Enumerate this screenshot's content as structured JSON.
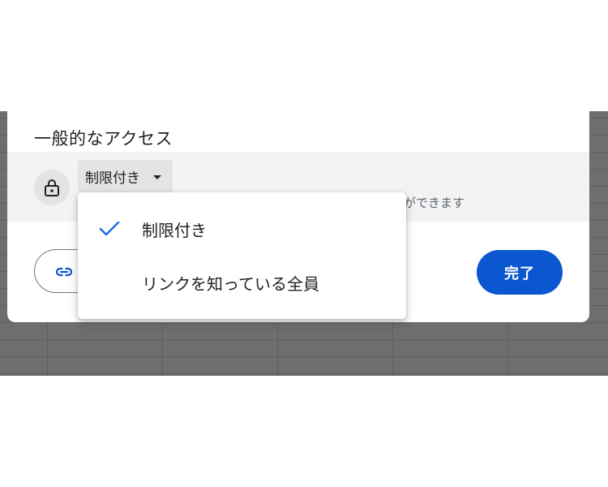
{
  "dialog": {
    "section_title": "一般的なアクセス",
    "access_select": {
      "selected_label": "制限付き",
      "icon": "lock-icon",
      "caret_icon": "caret-down-icon"
    },
    "access_description_visible": "とができます",
    "copy_link_button": {
      "icon": "link-icon"
    },
    "done_label": "完了"
  },
  "access_menu": {
    "items": [
      {
        "label": "制限付き",
        "selected": true,
        "icon": "check-icon"
      },
      {
        "label": "リンクを知っている全員",
        "selected": false
      }
    ]
  },
  "colors": {
    "primary": "#0b57d0",
    "check": "#1a73e8",
    "row_background": "#f1f3f4",
    "backdrop": "#6e6e6e"
  }
}
